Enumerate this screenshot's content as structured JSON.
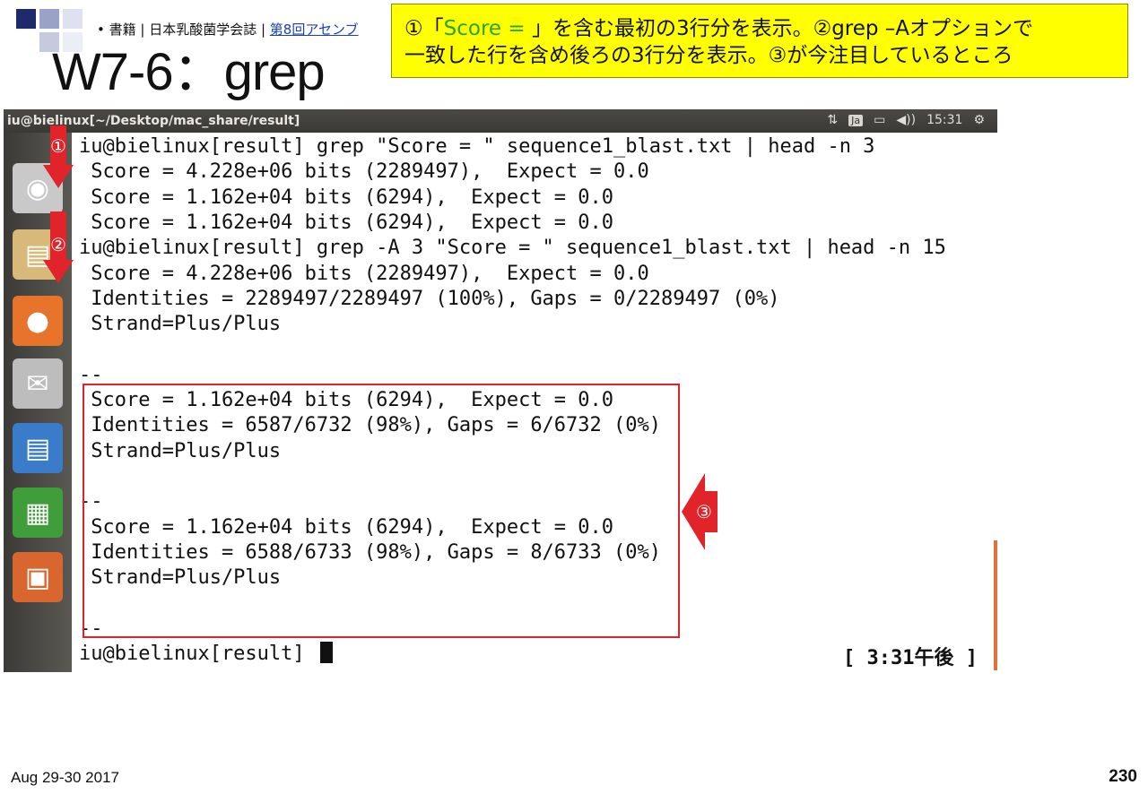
{
  "slide": {
    "bullet": "• 書籍 | 日本乳酸菌学会誌 | ",
    "bullet_link": "第8回アセンブ",
    "title": "W7-6：grep",
    "callout_line1_a": "①「",
    "callout_line1_hl": "Score = ",
    "callout_line1_b": "」を含む最初の3行分を表示。②grep –Aオプションで",
    "callout_line2": "一致した行を含め後ろの3行分を表示。③が今注目しているところ",
    "date": "Aug 29-30 2017",
    "page": "230",
    "markers": [
      "①",
      "②",
      "③"
    ]
  },
  "window": {
    "title": "iu@bielinux[~/Desktop/mac_share/result]",
    "tray": {
      "network_icon": "⇅",
      "lang": "Ja",
      "battery_icon": "▭",
      "volume_icon": "◀))",
      "time": "15:31",
      "gear_icon": "⚙"
    }
  },
  "launcher": [
    {
      "name": "dash-icon",
      "glyph": "◉",
      "bg": "#c9c9c9"
    },
    {
      "name": "files-icon",
      "glyph": "▤",
      "bg": "#d9b97a"
    },
    {
      "name": "firefox-icon",
      "glyph": "●",
      "bg": "#e8732a"
    },
    {
      "name": "mail-icon",
      "glyph": "✉",
      "bg": "#bdbdbd"
    },
    {
      "name": "writer-icon",
      "glyph": "▤",
      "bg": "#3a7cc9"
    },
    {
      "name": "calc-icon",
      "glyph": "▦",
      "bg": "#3f9d3a"
    },
    {
      "name": "impress-icon",
      "glyph": "▣",
      "bg": "#d9652f"
    }
  ],
  "terminal": {
    "lines": [
      "iu@bielinux[result] grep \"Score = \" sequence1_blast.txt | head -n 3",
      " Score = 4.228e+06 bits (2289497),  Expect = 0.0",
      " Score = 1.162e+04 bits (6294),  Expect = 0.0",
      " Score = 1.162e+04 bits (6294),  Expect = 0.0",
      "iu@bielinux[result] grep -A 3 \"Score = \" sequence1_blast.txt | head -n 15",
      " Score = 4.228e+06 bits (2289497),  Expect = 0.0",
      " Identities = 2289497/2289497 (100%), Gaps = 0/2289497 (0%)",
      " Strand=Plus/Plus",
      "",
      "--",
      " Score = 1.162e+04 bits (6294),  Expect = 0.0",
      " Identities = 6587/6732 (98%), Gaps = 6/6732 (0%)",
      " Strand=Plus/Plus",
      "",
      "--",
      " Score = 1.162e+04 bits (6294),  Expect = 0.0",
      " Identities = 6588/6733 (98%), Gaps = 8/6733 (0%)",
      " Strand=Plus/Plus",
      "",
      "--"
    ],
    "prompt": "iu@bielinux[result] ",
    "clock": "[ 3:31午後 ]"
  }
}
